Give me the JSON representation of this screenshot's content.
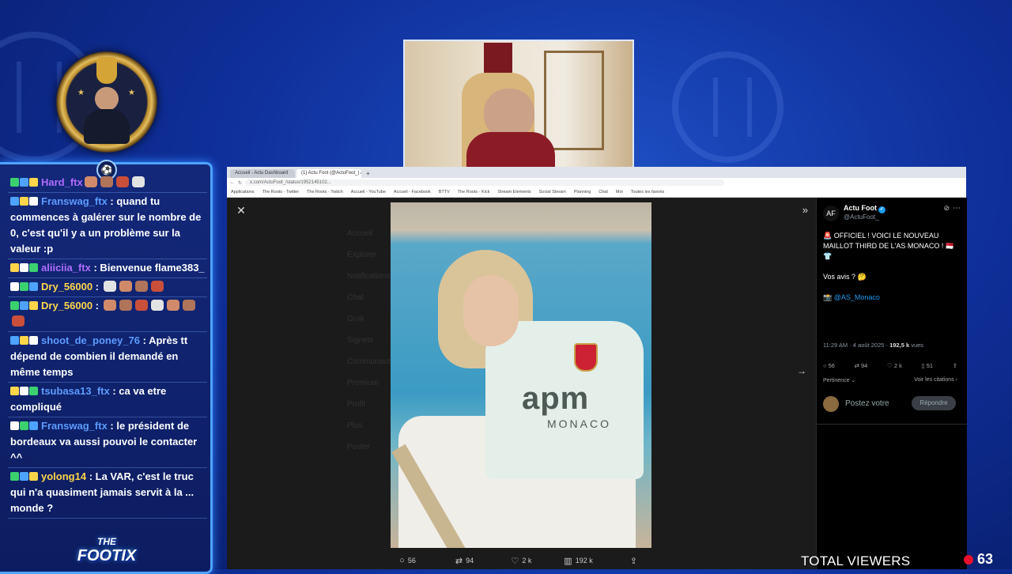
{
  "chat": {
    "messages": [
      {
        "user": "Hard_ftx",
        "user_color": "#b06cff",
        "text": "",
        "emotes": 4
      },
      {
        "user": "Franswag_ftx",
        "user_color": "#5c9cff",
        "text": " : quand tu commences à galérer sur le nombre de 0, c'est qu'il y a un problème sur la valeur :p"
      },
      {
        "user": "aliiciia_ftx",
        "user_color": "#b06cff",
        "text": " : Bienvenue flame383_ "
      },
      {
        "user": "Dry_56000",
        "user_color": "#ffd64a",
        "text": " : ",
        "emotes": 4
      },
      {
        "user": "Dry_56000",
        "user_color": "#ffd64a",
        "text": " : ",
        "emotes": 7
      },
      {
        "user": "shoot_de_poney_76",
        "user_color": "#5c9cff",
        "text": " : Après tt dépend de combien il demandé en même temps"
      },
      {
        "user": "tsubasa13_ftx",
        "user_color": "#5c9cff",
        "text": " : ca va etre compliqué"
      },
      {
        "user": "Franswag_ftx",
        "user_color": "#5c9cff",
        "text": " : le président de bordeaux va aussi pouvoi le contacter ^^"
      },
      {
        "user": "yolong14",
        "user_color": "#ffd64a",
        "text": " : La VAR, c'est le truc qui n'a quasiment jamais servit à la ... monde ?"
      }
    ],
    "logo_top": "THE",
    "logo_main": "FOOTIX"
  },
  "browser": {
    "tabs": [
      "Accueil - Actu Dashboard",
      "(1) Actu Foot (@ActuFoot_) / X"
    ],
    "new_tab": "+",
    "address": "x.com/ActuFoot_/status/1952145102...",
    "bookmarks": [
      "Applications",
      "The Roots - Twitter",
      "The Roots - Twitch",
      "Accueil - YouTube",
      "Accueil - Facebook",
      "BTTV",
      "The Roots - Kick",
      "Stream Elements",
      "Social Stream",
      "Planning",
      "Chat",
      "Moi",
      "Toutes les favoris"
    ]
  },
  "viewer": {
    "close": "✕",
    "expand": "»",
    "next": "→",
    "photo_sponsor": "apm",
    "photo_sponsor_sub": "MONACO",
    "actions": [
      {
        "icon": "○",
        "name": "reply",
        "count": "56"
      },
      {
        "icon": "⇄",
        "name": "repost",
        "count": "94"
      },
      {
        "icon": "♡",
        "name": "like",
        "count": "2 k"
      },
      {
        "icon": "▥",
        "name": "views",
        "count": "192 k"
      },
      {
        "icon": "⇪",
        "name": "share",
        "count": ""
      }
    ],
    "ghost_menu": [
      "Accueil",
      "Explorer",
      "Notifications",
      "Chat",
      "Grok",
      "Signets",
      "Communautés",
      "Premium",
      "Profil",
      "Plus",
      "Poster"
    ]
  },
  "tweet": {
    "logo": "AF",
    "name": "Actu Foot",
    "handle": "@ActuFoot_",
    "line1": "🚨 OFFICIEL ! VOICI LE NOUVEAU MAILLOT THIRD DE L'AS MONACO ! 🇲🇨 👕",
    "line2": "Vos avis ? 🤔",
    "mention": "📸 @AS_Monaco",
    "time": "11:29 AM · 4 août 2025 · ",
    "views": "192,5 k",
    "views_label": " vues",
    "stats": [
      "56",
      "94",
      "2 k",
      "51"
    ],
    "sort": "Pertinence",
    "quotes": "Voir les citations",
    "reply_placeholder": "Postez votre",
    "reply_button": "Répondre"
  },
  "overlay": {
    "viewers_label": "TOTAL VIEWERS",
    "viewers_count": "63"
  }
}
